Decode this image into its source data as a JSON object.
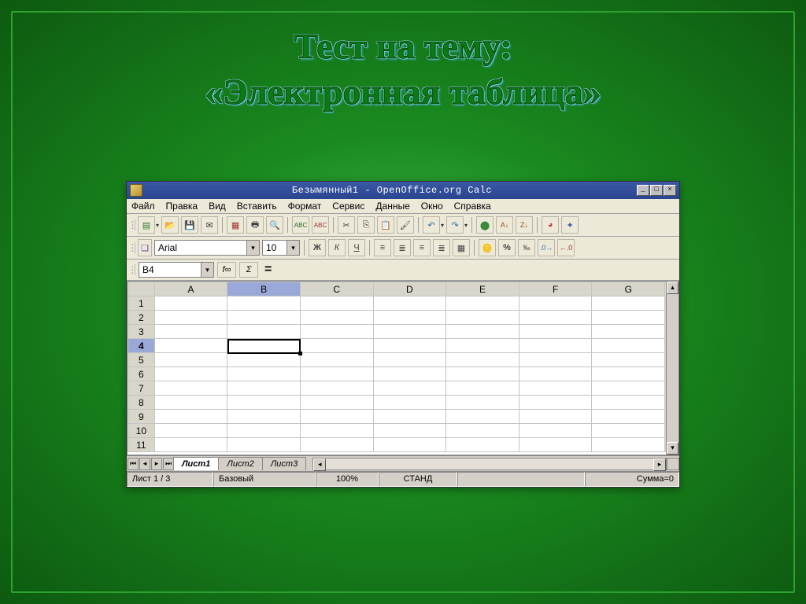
{
  "slide": {
    "title_line1": "Тест на тему:",
    "title_line2": "«Электронная таблица»"
  },
  "app": {
    "title": "Безымянный1 - OpenOffice.org Calc",
    "menu": [
      "Файл",
      "Правка",
      "Вид",
      "Вставить",
      "Формат",
      "Сервис",
      "Данные",
      "Окно",
      "Справка"
    ],
    "font_name": "Arial",
    "font_size": "10",
    "name_box": "B4",
    "fx_label": "f∞",
    "sigma_label": "Σ",
    "eq_label": "=",
    "bold": "Ж",
    "italic": "К",
    "underline": "Ч",
    "columns": [
      "A",
      "B",
      "C",
      "D",
      "E",
      "F",
      "G"
    ],
    "rows": [
      "1",
      "2",
      "3",
      "4",
      "5",
      "6",
      "7",
      "8",
      "9",
      "10",
      "11"
    ],
    "selected_col": "B",
    "selected_row": "4",
    "sheets": [
      "Лист1",
      "Лист2",
      "Лист3"
    ],
    "status": {
      "sheet_pos": "Лист 1 / 3",
      "style": "Базовый",
      "zoom": "100%",
      "mode": "СТАНД",
      "sum": "Сумма=0"
    }
  },
  "chart_data": {
    "type": "table",
    "columns": [
      "A",
      "B",
      "C",
      "D",
      "E",
      "F",
      "G"
    ],
    "rows": [
      {
        "row": "1",
        "A": "",
        "B": "",
        "C": "",
        "D": "",
        "E": "",
        "F": "",
        "G": ""
      },
      {
        "row": "2",
        "A": "",
        "B": "",
        "C": "",
        "D": "",
        "E": "",
        "F": "",
        "G": ""
      },
      {
        "row": "3",
        "A": "",
        "B": "",
        "C": "",
        "D": "",
        "E": "",
        "F": "",
        "G": ""
      },
      {
        "row": "4",
        "A": "",
        "B": "",
        "C": "",
        "D": "",
        "E": "",
        "F": "",
        "G": ""
      },
      {
        "row": "5",
        "A": "",
        "B": "",
        "C": "",
        "D": "",
        "E": "",
        "F": "",
        "G": ""
      },
      {
        "row": "6",
        "A": "",
        "B": "",
        "C": "",
        "D": "",
        "E": "",
        "F": "",
        "G": ""
      },
      {
        "row": "7",
        "A": "",
        "B": "",
        "C": "",
        "D": "",
        "E": "",
        "F": "",
        "G": ""
      },
      {
        "row": "8",
        "A": "",
        "B": "",
        "C": "",
        "D": "",
        "E": "",
        "F": "",
        "G": ""
      },
      {
        "row": "9",
        "A": "",
        "B": "",
        "C": "",
        "D": "",
        "E": "",
        "F": "",
        "G": ""
      },
      {
        "row": "10",
        "A": "",
        "B": "",
        "C": "",
        "D": "",
        "E": "",
        "F": "",
        "G": ""
      },
      {
        "row": "11",
        "A": "",
        "B": "",
        "C": "",
        "D": "",
        "E": "",
        "F": "",
        "G": ""
      }
    ],
    "active_cell": "B4"
  }
}
